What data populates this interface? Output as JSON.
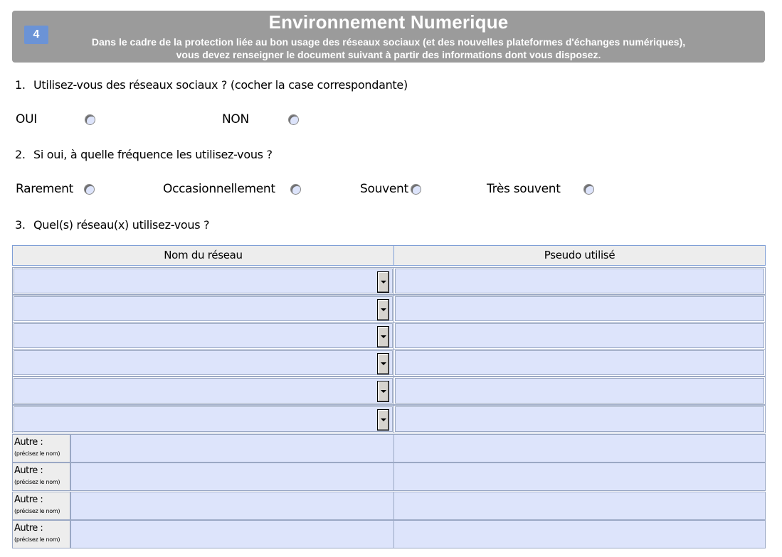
{
  "header": {
    "badge": "4",
    "title": "Environnement Numerique",
    "subtitle_line1": "Dans le cadre de la protection liée au bon usage des réseaux sociaux (et des nouvelles plateformes d'échanges numériques),",
    "subtitle_line2": "vous devez renseigner le document suivant à partir des informations dont vous disposez."
  },
  "q1": {
    "number": "1.",
    "text": "Utilisez-vous des réseaux sociaux ? (cocher la case correspondante)",
    "options": [
      "OUI",
      "NON"
    ]
  },
  "q2": {
    "number": "2.",
    "text": "Si oui, à quelle fréquence les utilisez-vous ?",
    "options": [
      "Rarement",
      "Occasionnellement",
      "Souvent",
      "Très souvent"
    ]
  },
  "q3": {
    "number": "3.",
    "text": "Quel(s) réseau(x) utilisez-vous ?"
  },
  "table": {
    "col1": "Nom du réseau",
    "col2": "Pseudo utilisé",
    "autre_label": "Autre :",
    "autre_hint": "(précisez le nom)"
  },
  "colors": {
    "header_bg": "#9b9b9b",
    "badge_bg": "#6b93d6",
    "field_bg": "#dde4fb",
    "table_border": "#7f9fd6"
  },
  "icons": {
    "dropdown": "chevron-down-icon",
    "radio": "radio-button-icon"
  }
}
